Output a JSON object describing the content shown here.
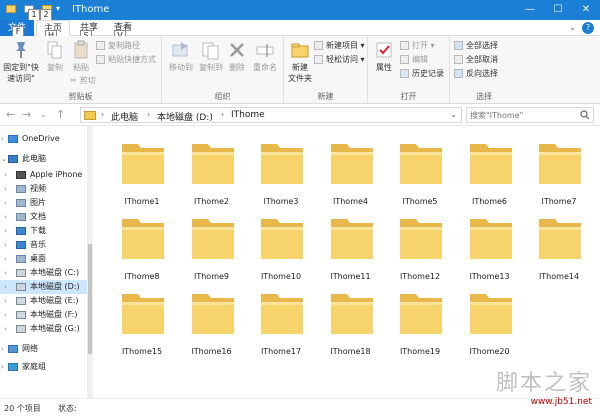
{
  "window": {
    "title": "IThome",
    "controls": {
      "minimize": "—",
      "maximize": "☐",
      "close": "✕"
    }
  },
  "quick_access": {
    "keytips": [
      "1",
      "2"
    ]
  },
  "ribbon_tabs": {
    "file": {
      "label": "文件",
      "keytip": "F"
    },
    "tabs": [
      {
        "label": "主页",
        "keytip": "H"
      },
      {
        "label": "共享",
        "keytip": "S"
      },
      {
        "label": "查看",
        "keytip": "V"
      }
    ],
    "help": "?"
  },
  "ribbon": {
    "clipboard": {
      "label": "剪贴板",
      "pin": "固定到\"快速访问\"",
      "copy": "复制",
      "paste": "粘贴",
      "copy_path": "复制路径",
      "paste_shortcut": "粘贴快捷方式",
      "cut": "剪切"
    },
    "organize": {
      "label": "组织",
      "move_to": "移动到",
      "copy_to": "复制到",
      "delete": "删除",
      "rename": "重命名"
    },
    "new": {
      "label": "新建",
      "new_folder": "新建\n文件夹",
      "new_item": "新建项目",
      "easy_access": "轻松访问"
    },
    "open": {
      "label": "打开",
      "properties": "属性",
      "open": "打开",
      "edit": "编辑",
      "history": "历史记录"
    },
    "select": {
      "label": "选择",
      "select_all": "全部选择",
      "select_none": "全部取消",
      "invert": "反向选择"
    }
  },
  "address": {
    "crumbs": [
      "此电脑",
      "本地磁盘 (D:)",
      "IThome"
    ],
    "search_placeholder": "搜索\"IThome\""
  },
  "nav": {
    "items": [
      {
        "label": "OneDrive",
        "icon": "cloud-icon",
        "chev": "›"
      },
      {
        "label": "此电脑",
        "icon": "computer-icon",
        "chev": "⌄"
      },
      {
        "label": "Apple iPhone",
        "icon": "phone-icon",
        "chev": "›"
      },
      {
        "label": "视频",
        "icon": "video-icon",
        "chev": "›"
      },
      {
        "label": "图片",
        "icon": "picture-icon",
        "chev": "›"
      },
      {
        "label": "文档",
        "icon": "document-icon",
        "chev": "›"
      },
      {
        "label": "下载",
        "icon": "download-icon",
        "chev": "›"
      },
      {
        "label": "音乐",
        "icon": "music-icon",
        "chev": "›"
      },
      {
        "label": "桌面",
        "icon": "desktop-icon",
        "chev": "›"
      },
      {
        "label": "本地磁盘 (C:)",
        "icon": "drive-icon",
        "chev": "›"
      },
      {
        "label": "本地磁盘 (D:)",
        "icon": "drive-icon",
        "chev": "›",
        "selected": true
      },
      {
        "label": "本地磁盘 (E:)",
        "icon": "drive-icon",
        "chev": "›"
      },
      {
        "label": "本地磁盘 (F:)",
        "icon": "drive-icon",
        "chev": "›"
      },
      {
        "label": "本地磁盘 (G:)",
        "icon": "drive-icon",
        "chev": "›"
      },
      {
        "label": "网络",
        "icon": "network-icon",
        "chev": "›"
      },
      {
        "label": "家庭组",
        "icon": "homegroup-icon",
        "chev": "›"
      }
    ]
  },
  "files": [
    "IThome1",
    "IThome2",
    "IThome3",
    "IThome4",
    "IThome5",
    "IThome6",
    "IThome7",
    "IThome8",
    "IThome9",
    "IThome10",
    "IThome11",
    "IThome12",
    "IThome13",
    "IThome14",
    "IThome15",
    "IThome16",
    "IThome17",
    "IThome18",
    "IThome19",
    "IThome20"
  ],
  "status": {
    "count": "20 个项目",
    "state": "状态:"
  },
  "watermark": {
    "line1": "脚本之家",
    "line2": "www.jb51.net"
  },
  "colors": {
    "accent": "#1b7fd6",
    "folder": "#f6d46b",
    "selection": "#cce6fb"
  }
}
